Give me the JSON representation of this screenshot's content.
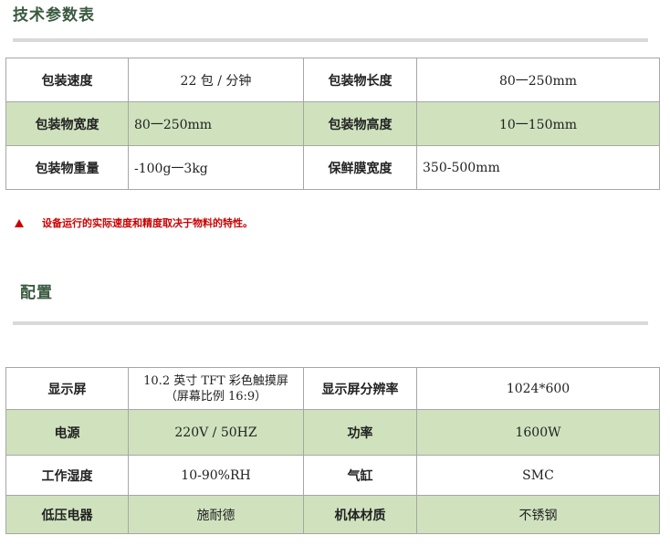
{
  "section1": {
    "title": "技术参数表",
    "rows": [
      [
        {
          "label": "包装速度"
        },
        {
          "value": "22 包 / 分钟",
          "align": "center"
        },
        {
          "label": "包装物长度"
        },
        {
          "value": "80一250mm",
          "align": "center"
        }
      ],
      [
        {
          "label": "包装物宽度"
        },
        {
          "value": "80一250mm",
          "align": "left"
        },
        {
          "label": "包装物高度"
        },
        {
          "value": "10一150mm",
          "align": "center"
        }
      ],
      [
        {
          "label": "包装物重量"
        },
        {
          "value": "-100g一3kg",
          "align": "left"
        },
        {
          "label": "保鲜膜宽度"
        },
        {
          "value": "350-500mm",
          "align": "left"
        }
      ]
    ],
    "note": "设备运行的实际速度和精度取决于物料的特性。"
  },
  "section2": {
    "title": "配置",
    "rows": [
      [
        {
          "label": "显示屏"
        },
        {
          "value": "10.2 英寸 TFT 彩色触摸屏（屏幕比例 16:9）",
          "align": "center"
        },
        {
          "label": "显示屏分辨率"
        },
        {
          "value": "1024*600",
          "align": "center"
        }
      ],
      [
        {
          "label": "电源"
        },
        {
          "value": "220V / 50HZ",
          "align": "center"
        },
        {
          "label": "功率"
        },
        {
          "value": "1600W",
          "align": "center"
        }
      ],
      [
        {
          "label": "工作湿度"
        },
        {
          "value": "10-90%RH",
          "align": "center"
        },
        {
          "label": "气缸"
        },
        {
          "value": "SMC",
          "align": "center"
        }
      ],
      [
        {
          "label": "低压电器"
        },
        {
          "value": "施耐德",
          "align": "center"
        },
        {
          "label": "机体材质"
        },
        {
          "value": "不锈钢",
          "align": "center"
        }
      ]
    ]
  },
  "colors": {
    "heading": "#3a5a40",
    "green_row": "#cfe2bd",
    "note": "#cc0000",
    "rule": "#d9d9d9"
  }
}
